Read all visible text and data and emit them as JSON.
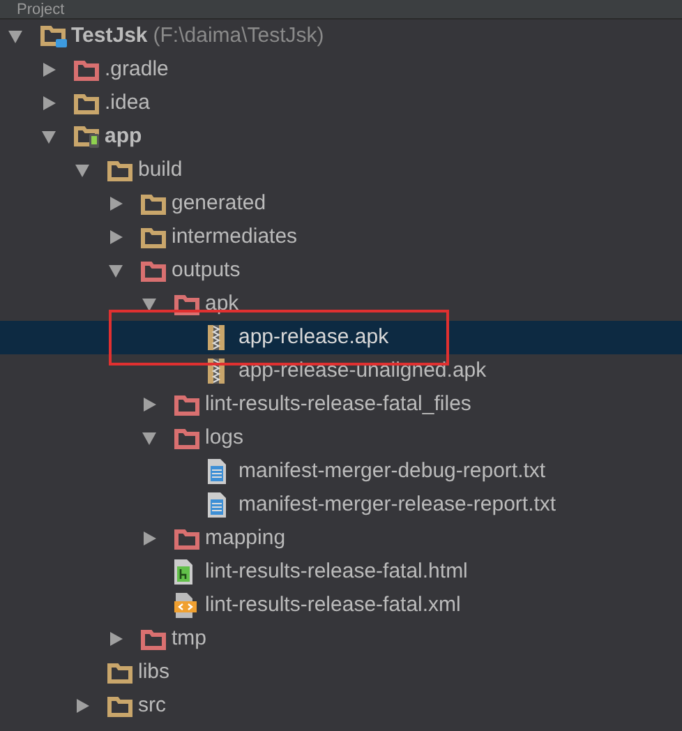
{
  "header": {
    "title": "Project"
  },
  "tree": [
    {
      "name": "TestJsk",
      "path": "(F:\\daima\\TestJsk)",
      "kind": "project",
      "expanded": true,
      "selected": false,
      "children": [
        {
          "name": ".gradle",
          "kind": "excluded_folder",
          "expanded": false,
          "selected": false
        },
        {
          "name": ".idea",
          "kind": "folder",
          "expanded": false,
          "selected": false
        },
        {
          "name": "app",
          "kind": "module",
          "expanded": true,
          "selected": false,
          "children": [
            {
              "name": "build",
              "kind": "folder",
              "expanded": true,
              "selected": false,
              "children": [
                {
                  "name": "generated",
                  "kind": "folder",
                  "expanded": false,
                  "selected": false
                },
                {
                  "name": "intermediates",
                  "kind": "folder",
                  "expanded": false,
                  "selected": false
                },
                {
                  "name": "outputs",
                  "kind": "excluded_folder",
                  "expanded": true,
                  "selected": false,
                  "children": [
                    {
                      "name": "apk",
                      "kind": "excluded_folder",
                      "expanded": true,
                      "selected": false,
                      "children": [
                        {
                          "name": "app-release.apk",
                          "kind": "archive",
                          "selected": true
                        },
                        {
                          "name": "app-release-unaligned.apk",
                          "kind": "archive",
                          "selected": false
                        }
                      ]
                    },
                    {
                      "name": "lint-results-release-fatal_files",
                      "kind": "excluded_folder",
                      "expanded": false,
                      "selected": false
                    },
                    {
                      "name": "logs",
                      "kind": "excluded_folder",
                      "expanded": true,
                      "selected": false,
                      "children": [
                        {
                          "name": "manifest-merger-debug-report.txt",
                          "kind": "text",
                          "selected": false
                        },
                        {
                          "name": "manifest-merger-release-report.txt",
                          "kind": "text",
                          "selected": false
                        }
                      ]
                    },
                    {
                      "name": "mapping",
                      "kind": "excluded_folder",
                      "expanded": false,
                      "selected": false
                    },
                    {
                      "name": "lint-results-release-fatal.html",
                      "kind": "html",
                      "selected": false
                    },
                    {
                      "name": "lint-results-release-fatal.xml",
                      "kind": "xml",
                      "selected": false
                    }
                  ]
                },
                {
                  "name": "tmp",
                  "kind": "excluded_folder",
                  "expanded": false,
                  "selected": false
                }
              ]
            },
            {
              "name": "libs",
              "kind": "folder",
              "selected": false
            },
            {
              "name": "src",
              "kind": "folder",
              "expanded": false,
              "selected": false
            }
          ]
        }
      ]
    }
  ]
}
